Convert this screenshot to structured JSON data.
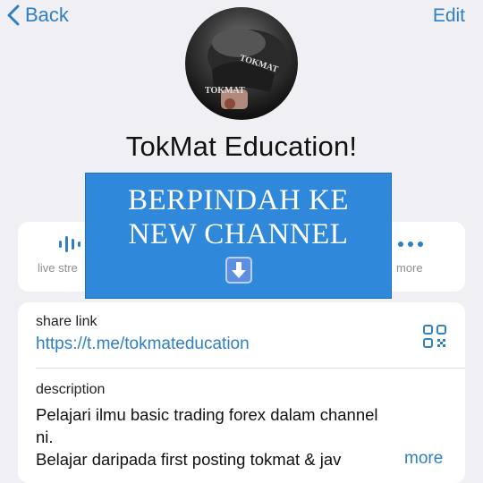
{
  "nav": {
    "back_label": "Back",
    "edit_label": "Edit"
  },
  "channel": {
    "name": "TokMat Education!",
    "avatar_text": "TOKMAT"
  },
  "actions": [
    {
      "label": "live stre",
      "icon": "live-stream-icon"
    },
    {
      "label": "more",
      "icon": "more-icon"
    }
  ],
  "banner": {
    "line1": "BERPINDAH KE",
    "line2": "NEW CHANNEL",
    "arrow": "⬇"
  },
  "share": {
    "label": "share link",
    "url": "https://t.me/tokmateducation",
    "icon": "qr-code-icon"
  },
  "description": {
    "label": "description",
    "line1": "Pelajari ilmu basic trading forex dalam channel",
    "line2": "ni.",
    "line3": "Belajar daripada first posting tokmat & jav",
    "more": "more"
  },
  "colors": {
    "accent": "#2f7fc4",
    "banner": "#2f88da",
    "background": "#efeff4"
  }
}
